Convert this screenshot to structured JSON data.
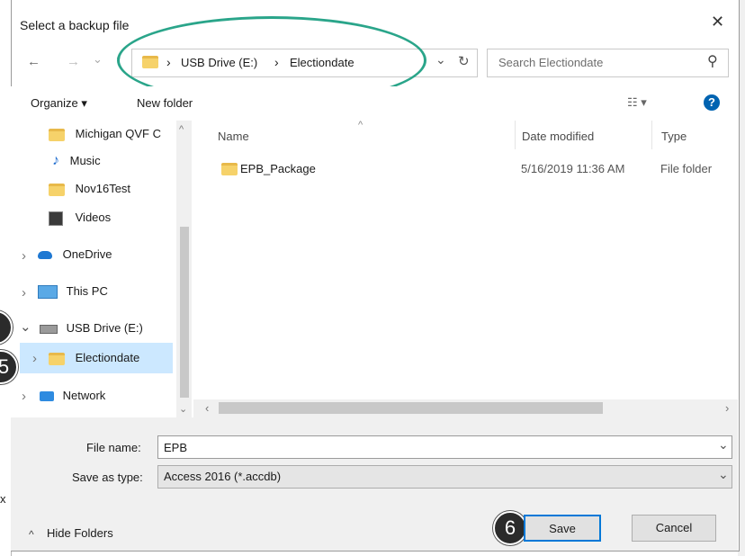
{
  "window": {
    "title": "Select a backup file",
    "close": "✕"
  },
  "nav": {
    "back": "←",
    "forward": "→",
    "recent": "⌄",
    "up": "↑"
  },
  "address": {
    "sep1": "›",
    "drive": "USB Drive (E:)",
    "sep2": "›",
    "folder": "Electiondate",
    "dropdown": "⌄",
    "refresh": "↻"
  },
  "search": {
    "placeholder": "Search Electiondate",
    "icon": "⚲"
  },
  "toolbar": {
    "organize": "Organize ▾",
    "new_folder": "New folder",
    "view": "☷ ▾",
    "help": "?"
  },
  "sidebar": {
    "items": [
      {
        "label": "Michigan QVF C",
        "icon": "folder"
      },
      {
        "label": "Music",
        "icon": "music-note"
      },
      {
        "label": "Nov16Test",
        "icon": "folder"
      },
      {
        "label": "Videos",
        "icon": "film"
      },
      {
        "label": "OneDrive",
        "icon": "cloud"
      },
      {
        "label": "This PC",
        "icon": "monitor"
      },
      {
        "label": "USB Drive (E:)",
        "icon": "usb-drive"
      },
      {
        "label": "Electiondate",
        "icon": "folder"
      },
      {
        "label": "Network",
        "icon": "network"
      }
    ],
    "expanders": {
      "closed": "›",
      "open": "⌄"
    },
    "scroll_up": "^",
    "scroll_down": "⌄"
  },
  "list": {
    "sort_indicator": "^",
    "columns": [
      "Name",
      "Date modified",
      "Type"
    ],
    "rows": [
      {
        "name": "EPB_Package",
        "date": "5/16/2019 11:36 AM",
        "type": "File folder"
      }
    ]
  },
  "hscroll": {
    "left": "‹",
    "right": "›"
  },
  "form": {
    "file_name_label": "File name:",
    "file_name_value": "EPB",
    "save_as_label": "Save as type:",
    "save_as_value": "Access 2016 (*.accdb)",
    "dropdown": "⌄"
  },
  "footer": {
    "hide_folders": "Hide Folders",
    "caret": "^",
    "save": "Save",
    "cancel": "Cancel"
  },
  "callouts": {
    "step5": "5",
    "step6": "6"
  },
  "outside": {
    "x": "x"
  },
  "colors": {
    "accent": "#0078d7",
    "selection": "#cce8ff",
    "ellipse": "#2aa58a",
    "help": "#0063b1"
  }
}
